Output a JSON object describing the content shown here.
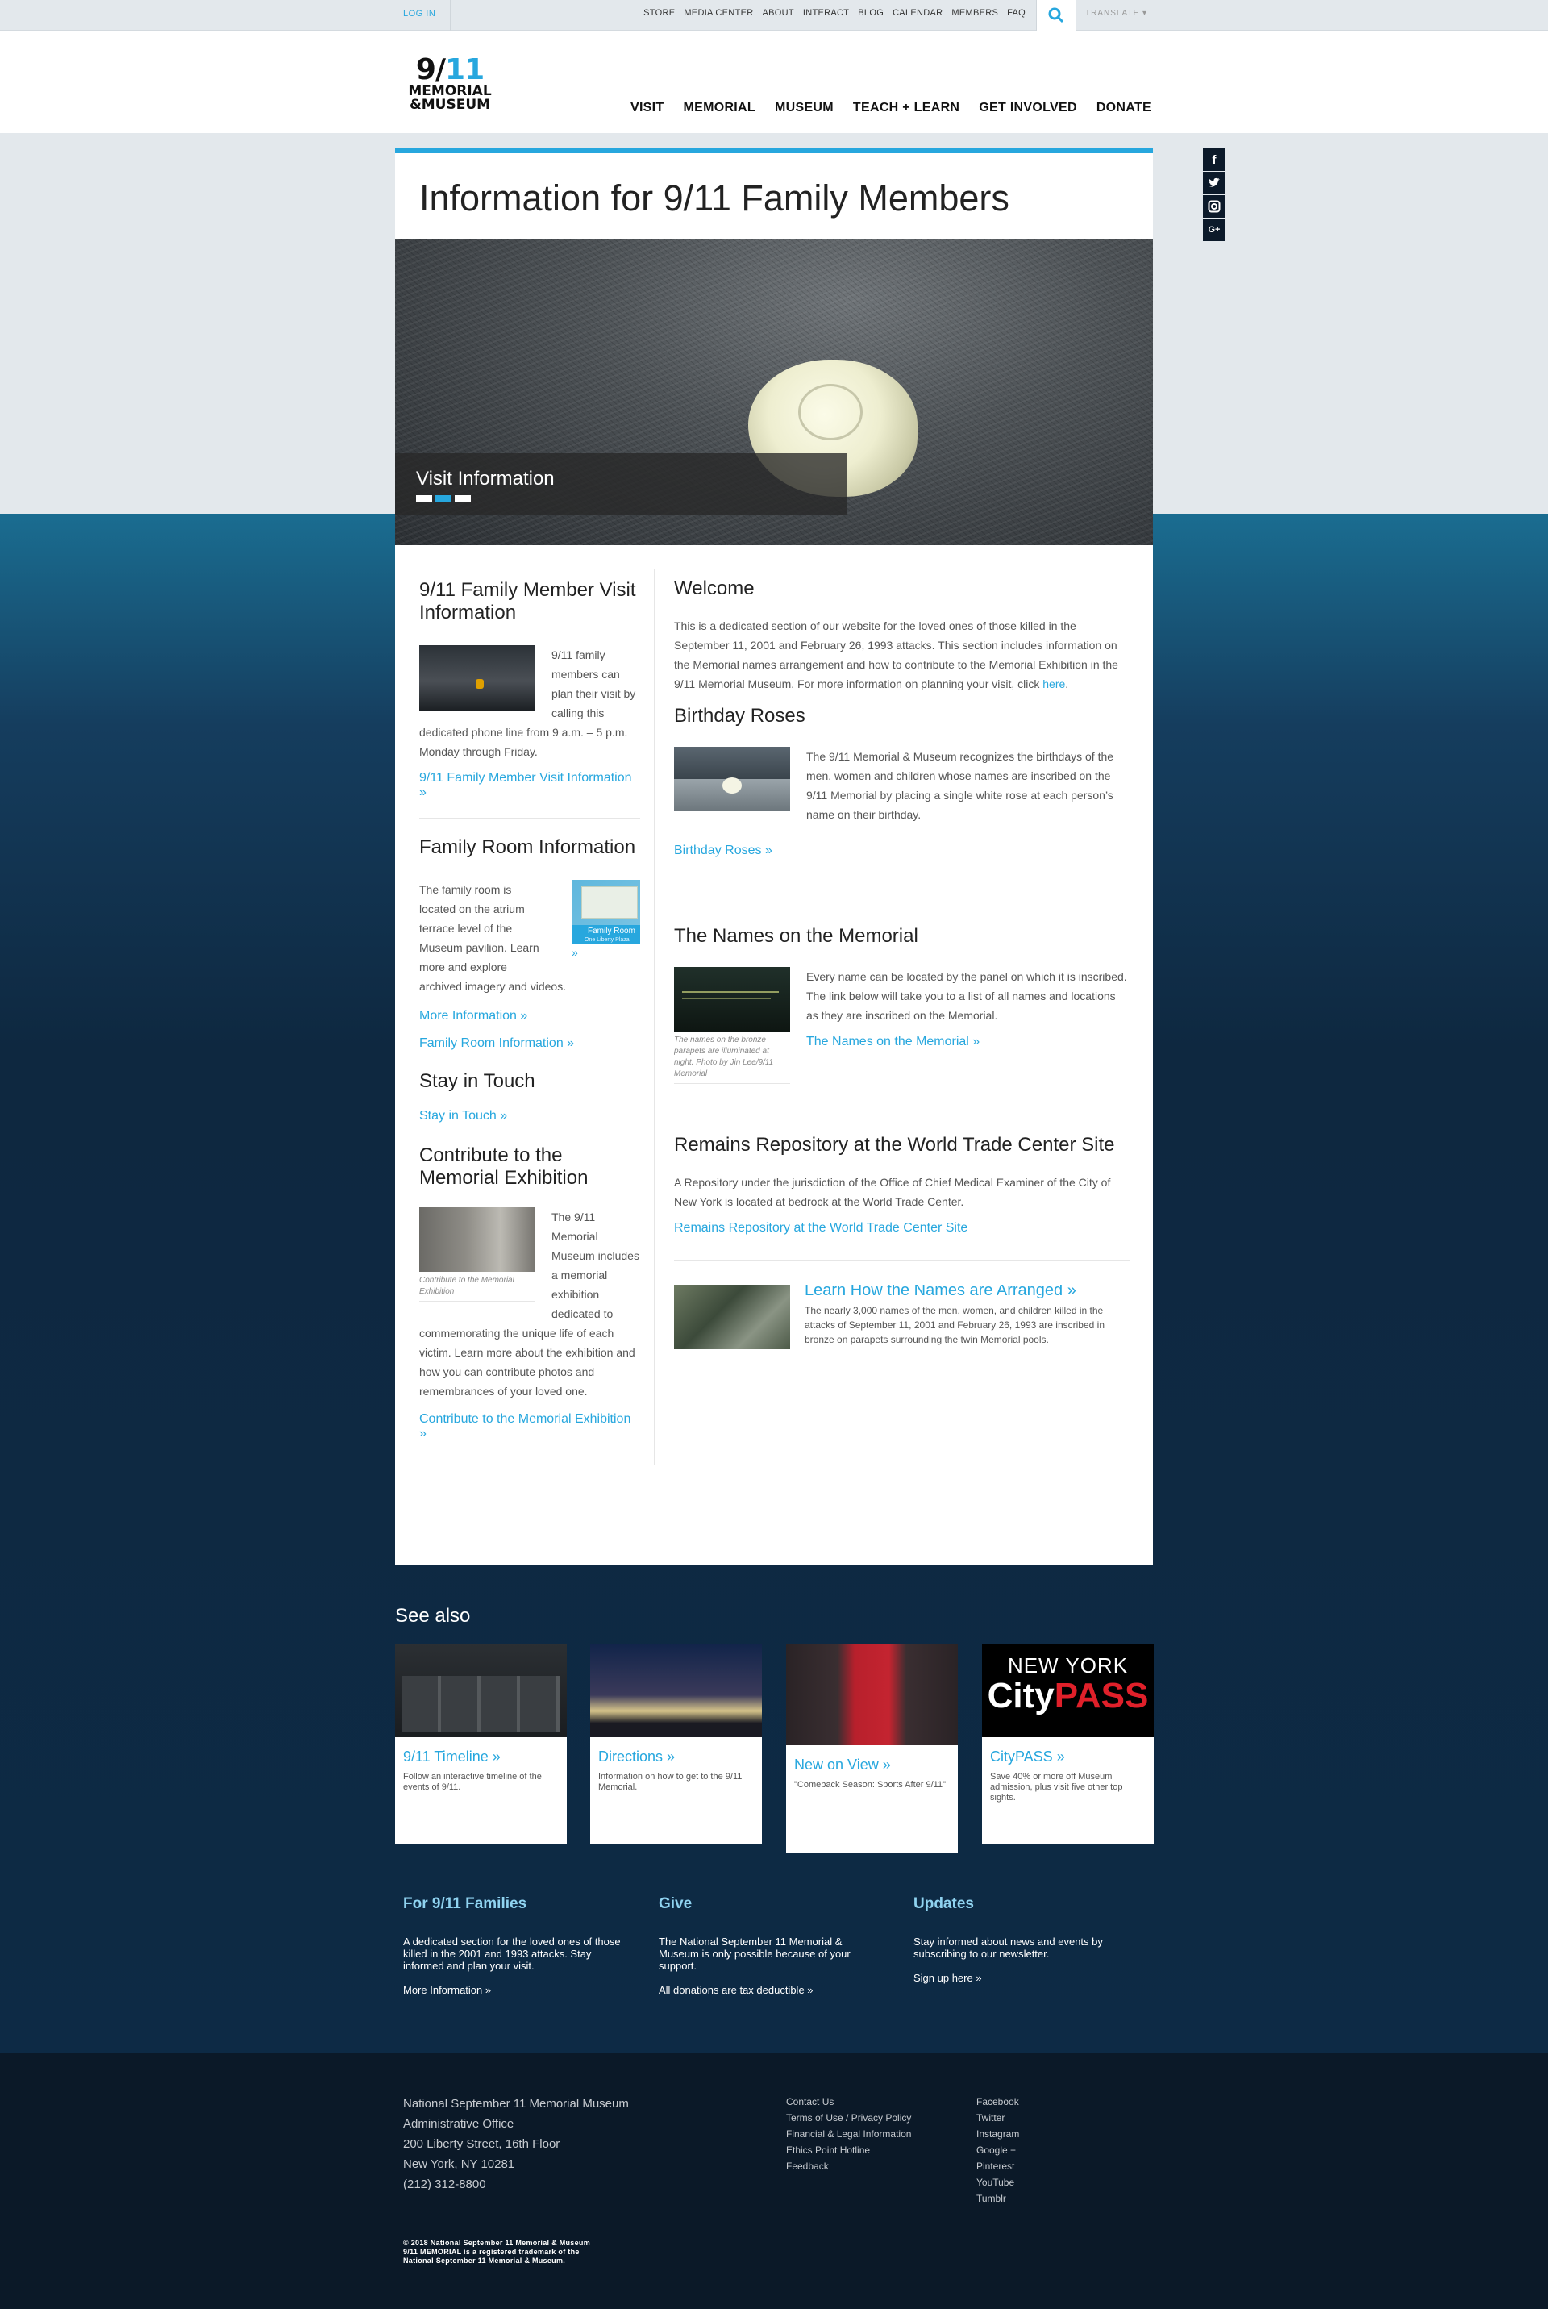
{
  "topbar": {
    "login": "LOG IN",
    "utility_links": [
      "STORE",
      "MEDIA CENTER",
      "ABOUT",
      "INTERACT",
      "BLOG",
      "CALENDAR",
      "MEMBERS",
      "FAQ"
    ],
    "translate": "TRANSLATE ▾"
  },
  "logo": {
    "num_a": "9/",
    "num_b": "11",
    "line1": "MEMORIAL",
    "line2": "&MUSEUM"
  },
  "nav": [
    "VISIT",
    "MEMORIAL",
    "MUSEUM",
    "TEACH + LEARN",
    "GET INVOLVED",
    "DONATE"
  ],
  "social": [
    "f",
    "t",
    "ig",
    "G+"
  ],
  "page": {
    "title": "Information for 9/11 Family Members",
    "hero_caption": "Visit Information"
  },
  "left": {
    "visit_title": "9/11 Family Member Visit Information",
    "visit_text": "9/11 family members can plan their visit by calling this dedicated phone line from 9 a.m. – 5 p.m. Monday through Friday.",
    "visit_link": "9/11 Family Member Visit Information »",
    "room_title": "Family Room Information",
    "room_text": "The family room is located on the atrium terrace level of the Museum pavilion. Learn more and explore archived imagery and videos.",
    "room_thumb_label": "Family Room",
    "room_thumb_sub": "One Liberty Plaza",
    "room_thumb_more": "»",
    "room_link1": "More Information »",
    "room_link2": "Family Room Information  »",
    "touch_title": "Stay in Touch",
    "touch_link": "Stay in Touch »",
    "contribute_title": "Contribute to the Memorial Exhibition",
    "contribute_caption": "Contribute to the Memorial Exhibition",
    "contribute_text": "The 9/11 Memorial Museum includes a memorial exhibition dedicated to commemorating the unique life of each victim. Learn more about the exhibition and how you can contribute photos and remembrances of your loved one.",
    "contribute_link": "Contribute to the Memorial Exhibition »"
  },
  "right": {
    "welcome_title": "Welcome",
    "welcome_text": "This is a dedicated section of our website for the loved ones of those killed in the September 11, 2001 and February 26, 1993 attacks. This section includes information on the Memorial names arrangement and how to contribute to the Memorial Exhibition in the 9/11 Memorial Museum. For more information on planning your visit, click ",
    "welcome_here": "here",
    "welcome_end": ".",
    "roses_title": "Birthday Roses",
    "roses_text": "The 9/11 Memorial & Museum recognizes the birthdays of the men, women and children whose names are inscribed on the 9/11 Memorial by placing a single white rose at each person’s name on their birthday.",
    "roses_link": "Birthday Roses »",
    "names_title": "The Names on the Memorial",
    "names_caption": "The names on the bronze parapets are illuminated at night. Photo by Jin Lee/9/11 Memorial",
    "names_text": "Every name can be located by the panel on which it is inscribed. The link below will take you to a list of all names and locations as they are inscribed on the Memorial.",
    "names_link": "The Names on the Memorial »",
    "remains_title": "Remains Repository at the World Trade Center Site",
    "remains_text": "A Repository under the jurisdiction of the Office of Chief Medical Examiner of the City of New York is located at bedrock at the World Trade Center.",
    "remains_link": "Remains Repository at the World Trade Center Site",
    "arranged_title": "Learn How the Names are Arranged »",
    "arranged_text": "The nearly 3,000 names of the men, women, and children killed in the attacks of September 11, 2001 and February 26, 1993 are inscribed in bronze on parapets surrounding the twin Memorial pools."
  },
  "see_also": {
    "title": "See also",
    "items": [
      {
        "title": "9/11 Timeline »",
        "desc": "Follow an interactive timeline of the events of 9/11."
      },
      {
        "title": "Directions »",
        "desc": "Information on how to get to the 9/11 Memorial."
      },
      {
        "title": "New on View »",
        "desc": "\"Comeback Season: Sports After 9/11\""
      },
      {
        "title": "CityPASS »",
        "desc": "Save 40% or more off Museum admission, plus visit five other top sights."
      }
    ],
    "citypass_top": "NEW YORK",
    "citypass_city": "City",
    "citypass_pass": "PASS"
  },
  "footer_cols": [
    {
      "title": "For 9/11 Families",
      "text": "A dedicated section for the loved ones of those killed in the 2001 and 1993 attacks. Stay informed and plan your visit.",
      "link": "More Information »"
    },
    {
      "title": "Give",
      "text": "The National September 11 Memorial & Museum is only possible because of your support.",
      "link": "All donations are tax deductible »"
    },
    {
      "title": "Updates",
      "text": "Stay informed about news and events by subscribing to our newsletter.",
      "link": "Sign up here »"
    }
  ],
  "address": [
    "National September 11 Memorial Museum",
    "Administrative Office",
    "200 Liberty Street, 16th Floor",
    "New York, NY 10281",
    "(212) 312-8800"
  ],
  "footer_links": [
    "Contact Us",
    "Terms of Use / Privacy Policy",
    "Financial & Legal Information",
    "Ethics Point Hotline",
    "Feedback"
  ],
  "footer_social": [
    "Facebook",
    "Twitter",
    "Instagram",
    "Google +",
    "Pinterest",
    "YouTube",
    "Tumblr"
  ],
  "copyright": [
    "© 2018 National September 11 Memorial & Museum",
    "9/11 MEMORIAL is a registered trademark of the",
    "National September 11 Memorial & Museum."
  ]
}
